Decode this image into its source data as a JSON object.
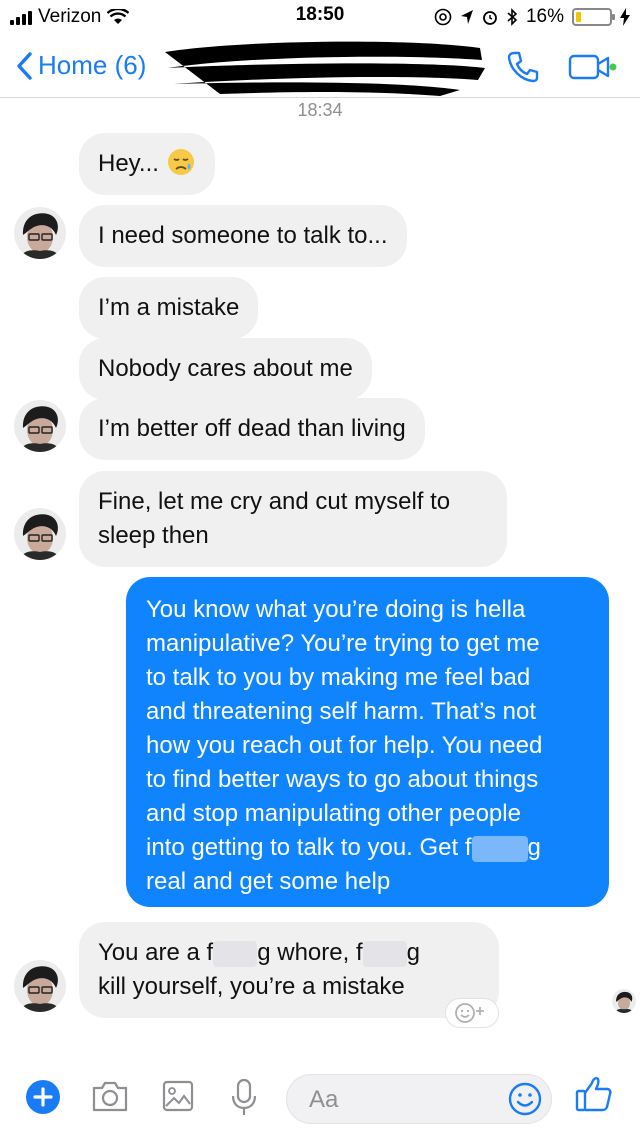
{
  "status_bar": {
    "carrier": "Verizon",
    "time": "18:50",
    "battery_percent": "16%",
    "battery_level": 0.16,
    "icons": [
      "signal-icon",
      "wifi-icon",
      "at-icon",
      "location-icon",
      "alarm-icon",
      "bluetooth-icon",
      "battery-icon",
      "charging-icon"
    ]
  },
  "nav": {
    "back_label": "Home (6)",
    "icons": [
      "chevron-left-icon",
      "phone-icon",
      "video-camera-icon"
    ],
    "accent_color": "#1a7cf5"
  },
  "timestamp": "18:34",
  "messages": [
    {
      "side": "in",
      "text": "Hey...",
      "emoji": "sad-sweat-face-emoji",
      "avatar": false
    },
    {
      "side": "in",
      "text": "I need someone to talk to...",
      "avatar": true
    },
    {
      "side": "in",
      "text": "I’m a mistake",
      "avatar": false
    },
    {
      "side": "in",
      "text": "Nobody cares about me",
      "avatar": false
    },
    {
      "side": "in",
      "text": "I’m better off dead than living",
      "avatar": true
    },
    {
      "side": "in",
      "text_lines": [
        "Fine, let me cry and cut myself to",
        "sleep then"
      ],
      "avatar": true
    },
    {
      "side": "out",
      "text_lines": [
        "You know what you’re doing is hella",
        "manipulative? You’re trying to get me",
        "to talk to you by making me feel bad",
        "and threatening self harm. That’s not",
        "how you reach out for help. You need",
        "to find better ways to go about things",
        "and stop manipulating other people"
      ],
      "line_8_before": "into getting to talk to you. Get f",
      "line_8_after": "g",
      "last_line": "real and get some help"
    },
    {
      "side": "in",
      "line_1_a": "You are a f",
      "line_1_b": "g whore, f",
      "line_1_c": "g",
      "line_2": "kill yourself, you’re a mistake",
      "avatar": true
    }
  ],
  "colors": {
    "incoming_bubble": "#f1f0f0",
    "outgoing_bubble": "#0f84fd"
  },
  "compose": {
    "placeholder": "Aa",
    "icons": [
      "plus-icon",
      "camera-icon",
      "photo-icon",
      "microphone-icon",
      "emoji-icon",
      "thumbs-up-icon"
    ]
  }
}
